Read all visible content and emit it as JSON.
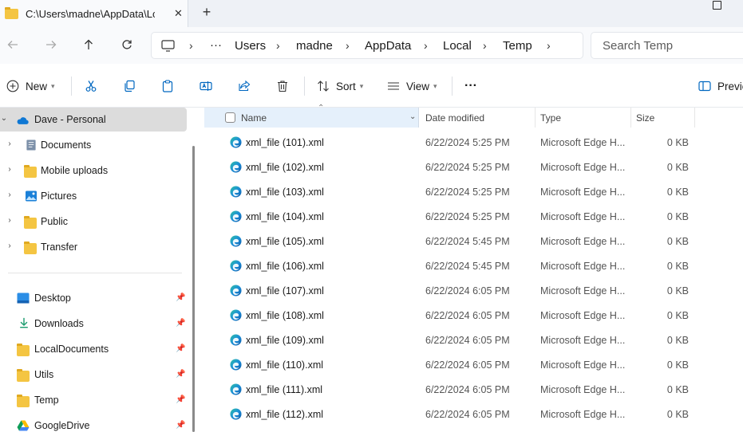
{
  "window": {
    "tab_title": "C:\\Users\\madne\\AppData\\Lc",
    "tab_close_glyph": "✕",
    "new_tab_glyph": "+"
  },
  "address": {
    "more_glyph": "···",
    "crumbs": [
      "Users",
      "madne",
      "AppData",
      "Local",
      "Temp"
    ],
    "search_placeholder": "Search Temp"
  },
  "commands": {
    "new_label": "New",
    "sort_label": "Sort",
    "view_label": "View",
    "more_glyph": "···",
    "preview_label": "Previe"
  },
  "sidebar": {
    "items": [
      {
        "label": "Dave - Personal",
        "icon": "onedrive-cloud-icon",
        "expanded": true
      },
      {
        "label": "Documents",
        "icon": "documents-icon"
      },
      {
        "label": "Mobile uploads",
        "icon": "folder-icon"
      },
      {
        "label": "Pictures",
        "icon": "pictures-icon"
      },
      {
        "label": "Public",
        "icon": "folder-icon"
      },
      {
        "label": "Transfer",
        "icon": "folder-icon"
      }
    ],
    "quick_access": [
      {
        "label": "Desktop",
        "icon": "desktop-icon"
      },
      {
        "label": "Downloads",
        "icon": "downloads-icon"
      },
      {
        "label": "LocalDocuments",
        "icon": "folder-icon"
      },
      {
        "label": "Utils",
        "icon": "folder-icon"
      },
      {
        "label": "Temp",
        "icon": "folder-icon"
      },
      {
        "label": "GoogleDrive",
        "icon": "google-drive-icon"
      }
    ]
  },
  "columns": {
    "name": "Name",
    "date": "Date modified",
    "type": "Type",
    "size": "Size"
  },
  "files": [
    {
      "name": "xml_file (101).xml",
      "date": "6/22/2024 5:25 PM",
      "type": "Microsoft Edge H...",
      "size": "0 KB"
    },
    {
      "name": "xml_file (102).xml",
      "date": "6/22/2024 5:25 PM",
      "type": "Microsoft Edge H...",
      "size": "0 KB"
    },
    {
      "name": "xml_file (103).xml",
      "date": "6/22/2024 5:25 PM",
      "type": "Microsoft Edge H...",
      "size": "0 KB"
    },
    {
      "name": "xml_file (104).xml",
      "date": "6/22/2024 5:25 PM",
      "type": "Microsoft Edge H...",
      "size": "0 KB"
    },
    {
      "name": "xml_file (105).xml",
      "date": "6/22/2024 5:45 PM",
      "type": "Microsoft Edge H...",
      "size": "0 KB"
    },
    {
      "name": "xml_file (106).xml",
      "date": "6/22/2024 5:45 PM",
      "type": "Microsoft Edge H...",
      "size": "0 KB"
    },
    {
      "name": "xml_file (107).xml",
      "date": "6/22/2024 6:05 PM",
      "type": "Microsoft Edge H...",
      "size": "0 KB"
    },
    {
      "name": "xml_file (108).xml",
      "date": "6/22/2024 6:05 PM",
      "type": "Microsoft Edge H...",
      "size": "0 KB"
    },
    {
      "name": "xml_file (109).xml",
      "date": "6/22/2024 6:05 PM",
      "type": "Microsoft Edge H...",
      "size": "0 KB"
    },
    {
      "name": "xml_file (110).xml",
      "date": "6/22/2024 6:05 PM",
      "type": "Microsoft Edge H...",
      "size": "0 KB"
    },
    {
      "name": "xml_file (111).xml",
      "date": "6/22/2024 6:05 PM",
      "type": "Microsoft Edge H...",
      "size": "0 KB"
    },
    {
      "name": "xml_file (112).xml",
      "date": "6/22/2024 6:05 PM",
      "type": "Microsoft Edge H...",
      "size": "0 KB"
    }
  ],
  "colors": {
    "accent": "#0067c0",
    "folder": "#f4c542",
    "selected_sidebar": "#dcdcdc",
    "header_highlight": "#e5f0fb"
  }
}
